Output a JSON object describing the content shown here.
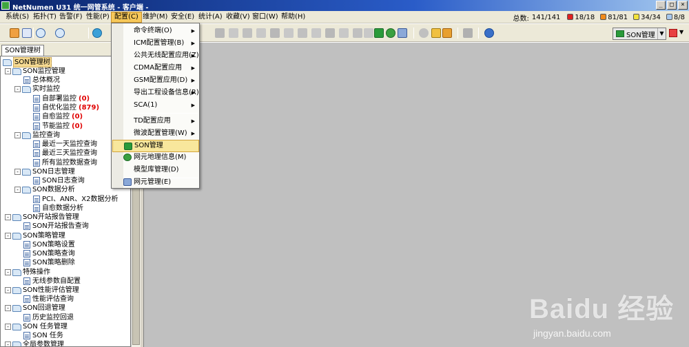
{
  "window": {
    "title": "NetNumen U31 统一网管系统 - 客户端 -",
    "buttons": [
      "_",
      "□",
      "×"
    ]
  },
  "menubar": {
    "items": [
      {
        "label": "系统(S)"
      },
      {
        "label": "拓扑(T)"
      },
      {
        "label": "告警(F)"
      },
      {
        "label": "性能(P)"
      },
      {
        "label": "配置(C)",
        "active": true
      },
      {
        "label": "维护(M)"
      },
      {
        "label": "安全(E)"
      },
      {
        "label": "统计(A)"
      },
      {
        "label": "收藏(V)"
      },
      {
        "label": "窗口(W)"
      },
      {
        "label": "帮助(H)"
      }
    ]
  },
  "status": {
    "total_label": "总数:",
    "total_value": "141/141",
    "critical": {
      "value": "18/18",
      "color": "#e02020"
    },
    "major": {
      "value": "81/81",
      "color": "#f08a1a"
    },
    "minor": {
      "value": "34/34",
      "color": "#f2e23a"
    },
    "warning": {
      "value": "8/8",
      "color": "#a8c8ec"
    }
  },
  "toolbar": {
    "son_combo": "SON管理"
  },
  "left_panel": {
    "tab_label": "SON管理树",
    "tree": [
      {
        "label": "SON管理树",
        "level": 0,
        "type": "folder",
        "selected": true
      },
      {
        "label": "SON监控管理",
        "level": 1,
        "type": "folder",
        "expander": "-"
      },
      {
        "label": "总体概况",
        "level": 2,
        "type": "doc"
      },
      {
        "label": "实时监控",
        "level": 2,
        "type": "folder",
        "expander": "-"
      },
      {
        "label": "自部署监控",
        "count": "(0)",
        "level": 3,
        "type": "doc"
      },
      {
        "label": "自优化监控",
        "count": "(879)",
        "level": 3,
        "type": "doc"
      },
      {
        "label": "自愈监控",
        "count": "(0)",
        "level": 3,
        "type": "doc"
      },
      {
        "label": "节能监控",
        "count": "(0)",
        "level": 3,
        "type": "doc"
      },
      {
        "label": "监控查询",
        "level": 2,
        "type": "folder",
        "expander": "-"
      },
      {
        "label": "最近一天监控查询",
        "level": 3,
        "type": "doc"
      },
      {
        "label": "最近三天监控查询",
        "level": 3,
        "type": "doc"
      },
      {
        "label": "所有监控数据查询",
        "level": 3,
        "type": "doc"
      },
      {
        "label": "SON日志管理",
        "level": 2,
        "type": "folder",
        "expander": "-"
      },
      {
        "label": "SON日志查询",
        "level": 3,
        "type": "doc"
      },
      {
        "label": "SON数据分析",
        "level": 2,
        "type": "folder",
        "expander": "-"
      },
      {
        "label": "PCI、ANR、X2数据分析",
        "level": 3,
        "type": "doc"
      },
      {
        "label": "自愈数据分析",
        "level": 3,
        "type": "doc"
      },
      {
        "label": "SON开站报告管理",
        "level": 1,
        "type": "folder",
        "expander": "-"
      },
      {
        "label": "SON开站报告查询",
        "level": 2,
        "type": "doc"
      },
      {
        "label": "SON策略管理",
        "level": 1,
        "type": "folder",
        "expander": "-"
      },
      {
        "label": "SON策略设置",
        "level": 2,
        "type": "doc"
      },
      {
        "label": "SON策略查询",
        "level": 2,
        "type": "doc"
      },
      {
        "label": "SON策略删除",
        "level": 2,
        "type": "doc"
      },
      {
        "label": "特殊操作",
        "level": 1,
        "type": "folder",
        "expander": "-"
      },
      {
        "label": "无线参数自配置",
        "level": 2,
        "type": "doc"
      },
      {
        "label": "SON性能评估管理",
        "level": 1,
        "type": "folder",
        "expander": "-"
      },
      {
        "label": "性能评估查询",
        "level": 2,
        "type": "doc"
      },
      {
        "label": "SON回退管理",
        "level": 1,
        "type": "folder",
        "expander": "-"
      },
      {
        "label": "历史监控回退",
        "level": 2,
        "type": "doc"
      },
      {
        "label": "SON 任务管理",
        "level": 1,
        "type": "folder",
        "expander": "-"
      },
      {
        "label": "SON 任务",
        "level": 2,
        "type": "doc"
      },
      {
        "label": "全局参数管理",
        "level": 1,
        "type": "folder",
        "expander": "-"
      }
    ]
  },
  "config_menu": {
    "items": [
      {
        "label": "命令终端(O)",
        "submenu": true
      },
      {
        "label": "ICM配置管理(B)",
        "submenu": true
      },
      {
        "label": "公共无线配置应用(Z)",
        "submenu": true
      },
      {
        "label": "CDMA配置应用",
        "submenu": true
      },
      {
        "label": "GSM配置应用(D)",
        "submenu": true
      },
      {
        "label": "导出工程设备信息(R)",
        "submenu": true
      },
      {
        "label": "SCA(1)",
        "submenu": true
      },
      {
        "separator": true
      },
      {
        "label": "TD配置应用",
        "submenu": true
      },
      {
        "label": "微波配置管理(W)",
        "submenu": true
      },
      {
        "separator": true
      },
      {
        "label": "SON管理",
        "icon": "son-icon",
        "highlight": true
      },
      {
        "label": "网元地理信息(M)",
        "icon": "globe-icon"
      },
      {
        "label": "模型库管理(D)"
      },
      {
        "separator": true
      },
      {
        "label": "网元管理(E)",
        "icon": "ne-icon"
      }
    ]
  },
  "watermark": {
    "logo": "Baidu 经验",
    "url": "jingyan.baidu.com"
  }
}
